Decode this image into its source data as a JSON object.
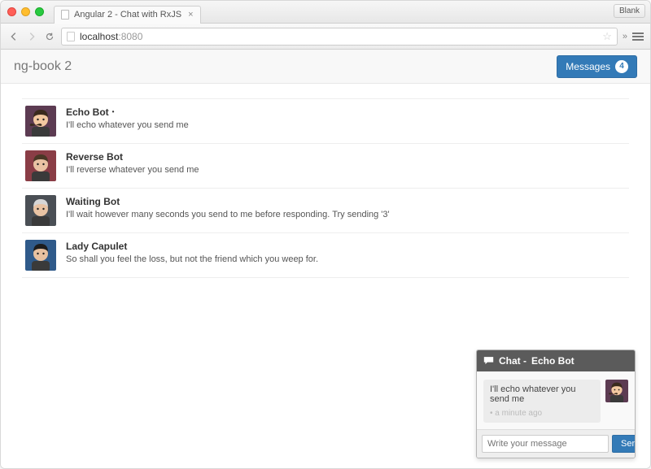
{
  "chrome": {
    "tab_title": "Angular 2 - Chat with RxJS",
    "blank_label": "Blank",
    "url_host": "localhost",
    "url_path": ":8080"
  },
  "navbar": {
    "brand": "ng-book 2",
    "messages_label": "Messages",
    "badge_count": "4"
  },
  "threads": [
    {
      "name": "Echo Bot",
      "unread": true,
      "msg": "I'll echo whatever you send me",
      "avatar": {
        "bg": "#5c3b52",
        "skin": "#f2c8a0",
        "hair": "#3a2a1d",
        "mustache": true
      }
    },
    {
      "name": "Reverse Bot",
      "unread": false,
      "msg": "I'll reverse whatever you send me",
      "avatar": {
        "bg": "#8a3d46",
        "skin": "#e9c3a3",
        "hair": "#4a3726",
        "mustache": false
      }
    },
    {
      "name": "Waiting Bot",
      "unread": false,
      "msg": "I'll wait however many seconds you send to me before responding. Try sending '3'",
      "avatar": {
        "bg": "#4a4f55",
        "skin": "#e9c3a3",
        "hair": "#d6d6d6",
        "mustache": false
      }
    },
    {
      "name": "Lady Capulet",
      "unread": false,
      "msg": "So shall you feel the loss, but not the friend which you weep for.",
      "avatar": {
        "bg": "#2f5a8a",
        "skin": "#e8c1a0",
        "hair": "#1d1d1d",
        "mustache": false
      }
    }
  ],
  "chat": {
    "header_prefix": "Chat - ",
    "header_name": "Echo Bot",
    "message_text": "I'll echo whatever you send me",
    "timestamp": "• a minute ago",
    "input_placeholder": "Write your message",
    "send_label": "Send",
    "avatar": {
      "bg": "#5c3b52",
      "skin": "#f2c8a0",
      "hair": "#3a2a1d",
      "mustache": true
    }
  }
}
